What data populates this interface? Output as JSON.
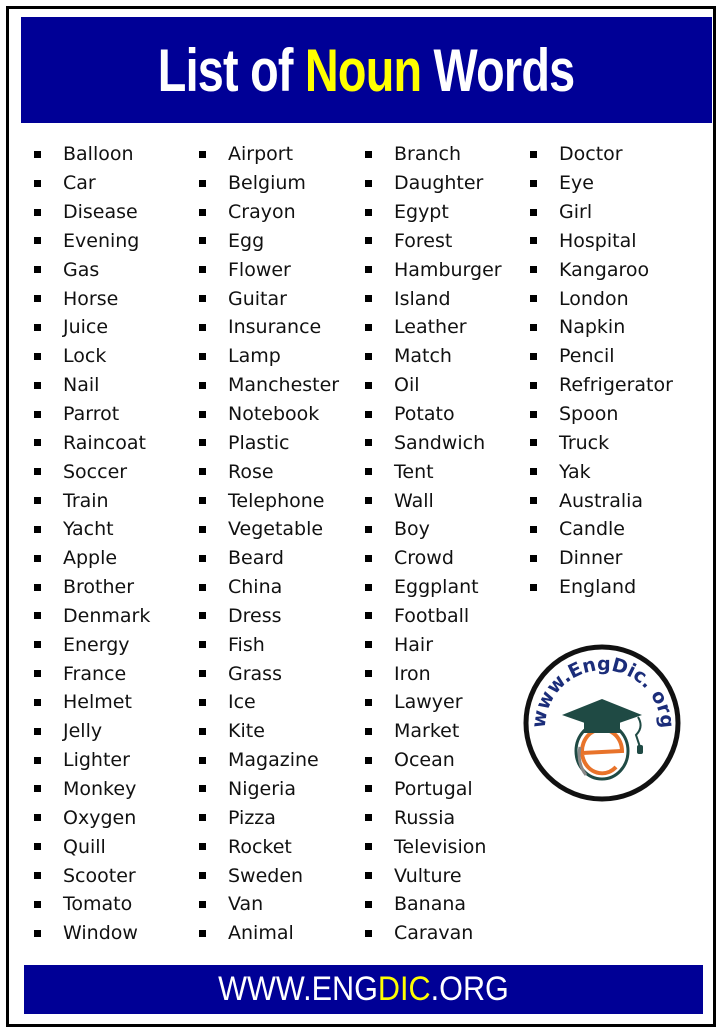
{
  "header": {
    "title_part1": "List of ",
    "title_highlight": "Noun",
    "title_part2": " Words"
  },
  "columns": [
    [
      "Balloon",
      "Car",
      "Disease",
      "Evening",
      "Gas",
      "Horse",
      "Juice",
      "Lock",
      "Nail",
      "Parrot",
      "Raincoat",
      "Soccer",
      "Train",
      "Yacht",
      "Apple",
      "Brother",
      "Denmark",
      "Energy",
      "France",
      "Helmet",
      "Jelly",
      "Lighter",
      "Monkey",
      "Oxygen",
      "Quill",
      "Scooter",
      "Tomato",
      "Window"
    ],
    [
      "Airport",
      "Belgium",
      "Crayon",
      "Egg",
      "Flower",
      "Guitar",
      "Insurance",
      "Lamp",
      "Manchester",
      "Notebook",
      "Plastic",
      "Rose",
      "Telephone",
      "Vegetable",
      "Beard",
      "China",
      "Dress",
      "Fish",
      "Grass",
      "Ice",
      "Kite",
      "Magazine",
      "Nigeria",
      "Pizza",
      "Rocket",
      "Sweden",
      "Van",
      "Animal"
    ],
    [
      "Branch",
      "Daughter",
      "Egypt",
      "Forest",
      "Hamburger",
      "Island",
      "Leather",
      "Match",
      "Oil",
      "Potato",
      "Sandwich",
      "Tent",
      "Wall",
      "Boy",
      "Crowd",
      "Eggplant",
      "Football",
      "Hair",
      "Iron",
      "Lawyer",
      "Market",
      "Ocean",
      "Portugal",
      "Russia",
      "Television",
      "Vulture",
      "Banana",
      "Caravan"
    ],
    [
      "Doctor",
      "Eye",
      "Girl",
      "Hospital",
      "Kangaroo",
      "London",
      "Napkin",
      "Pencil",
      "Refrigerator",
      "Spoon",
      "Truck",
      "Yak",
      "Australia",
      "Candle",
      "Dinner",
      "England"
    ]
  ],
  "logo": {
    "icon": "engdic-logo-icon",
    "arc_text_left": "www.",
    "arc_text_main": "EngDic",
    "arc_text_right": ". org"
  },
  "footer": {
    "part1": "WWW.ENG",
    "highlight": "DIC",
    "part2": ".ORG"
  },
  "colors": {
    "banner_blue": "#000096",
    "highlight_yellow": "#ffff00",
    "logo_orange": "#e8732a",
    "logo_green": "#1f4a44",
    "logo_text_blue": "#1b2d7a"
  }
}
